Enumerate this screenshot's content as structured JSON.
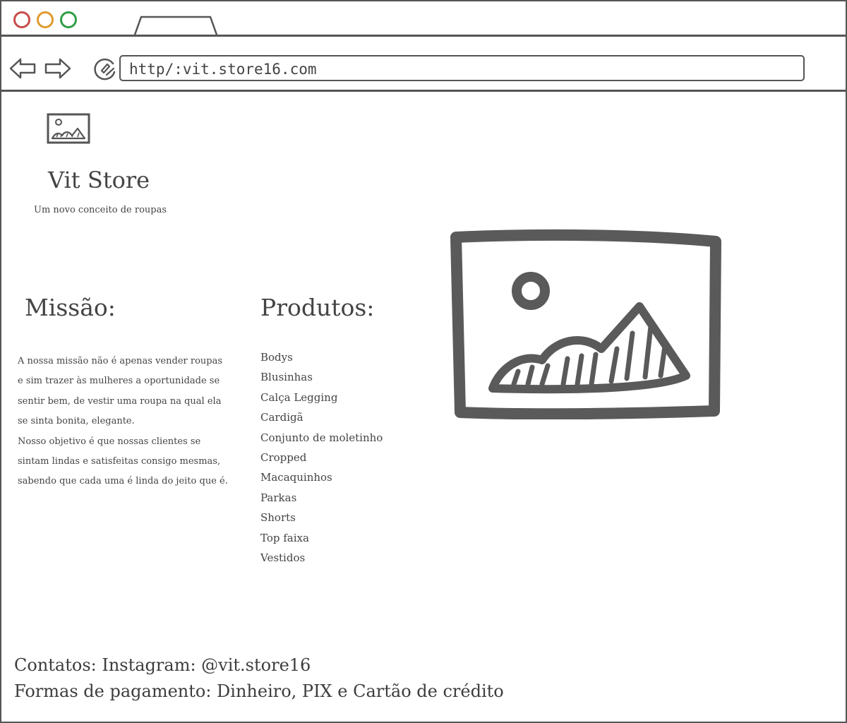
{
  "browser": {
    "url": "http/:vit.store16.com",
    "icons": [
      "back-arrow-icon",
      "forward-arrow-icon",
      "reload-icon"
    ]
  },
  "header": {
    "title": "Vit Store",
    "tagline": "Um novo conceito de roupas"
  },
  "missao": {
    "heading": "Missão:",
    "paragraph1": "A nossa missão não é apenas vender roupas e sim trazer às mulheres a oportunidade se sentir bem, de vestir uma roupa na qual ela se sinta bonita, elegante.",
    "paragraph2": "Nosso objetivo é que nossas clientes se sintam lindas e satisfeitas consigo mesmas, sabendo que cada uma é linda do jeito que é."
  },
  "produtos": {
    "heading": "Produtos:",
    "items": [
      "Bodys",
      "Blusinhas",
      "Calça Legging",
      "Cardigã",
      "Conjunto de moletinho",
      "Cropped",
      "Macaquinhos",
      "Parkas",
      "Shorts",
      "Top faixa",
      "Vestidos"
    ]
  },
  "footer": {
    "contatos": "Contatos: Instagram: @vit.store16",
    "pagamento": "Formas de pagamento: Dinheiro, PIX e Cartão de crédito"
  },
  "colors": {
    "ink": "#444444",
    "close_dot": "#c94b4b",
    "minimize_dot": "#e09a2f",
    "maximize_dot": "#2f9e44"
  }
}
